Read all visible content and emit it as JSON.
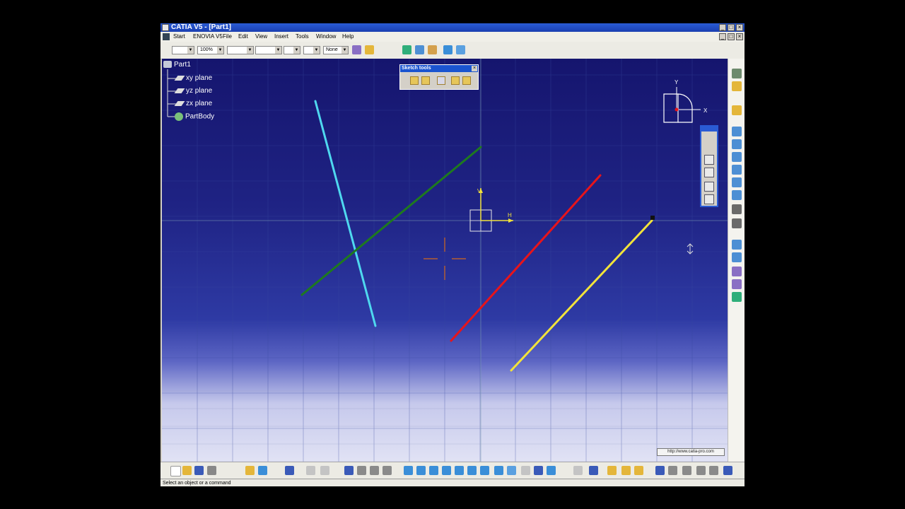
{
  "window": {
    "title": "CATIA V5 - [Part1]",
    "controls": {
      "minimize": "_",
      "maximize": "□",
      "close": "×"
    }
  },
  "menu": {
    "items": [
      "Start",
      "ENOVIA V5",
      "File",
      "Edit",
      "View",
      "Insert",
      "Tools",
      "Window",
      "Help"
    ]
  },
  "toolbar": {
    "zoom_value": "100%",
    "line_value": "None",
    "icons": [
      "line-type-icon",
      "sketch-line-icon",
      "spline-icon",
      "draft-icon",
      "surface-icon",
      "rotate-view-icon"
    ]
  },
  "tree": {
    "root": "Part1",
    "children": [
      "xy plane",
      "yz plane",
      "zx plane",
      "PartBody"
    ]
  },
  "sketch_tools": {
    "title": "Sketch tools",
    "close": "×",
    "icons": [
      "grid-icon",
      "snap-to-point-icon",
      "construction-element-icon",
      "geometrical-constraints-icon",
      "dimensional-constraints-icon"
    ]
  },
  "compass": {
    "x_label": "X",
    "y_label": "Y"
  },
  "sketch_axis": {
    "h_label": "H",
    "v_label": "V"
  },
  "colors": {
    "cyan_line": "#4fd8ef",
    "green_line": "#1e7a1e",
    "red_line": "#e8141a",
    "yellow_line": "#f2e33a",
    "background_top": "#15156e",
    "background_bottom": "#e9eaf7",
    "crosshair": "#d2691e"
  },
  "watermark": "http://www.catia-pro.com",
  "bottom_toolbar": {
    "icons": [
      "new-icon",
      "open-icon",
      "save-icon",
      "print-icon",
      "cut-icon",
      "undo-icon",
      "help-icon",
      "fx-formula-icon",
      "zoom-icon",
      "pan-icon",
      "rotate-icon",
      "zoom-in-icon",
      "zoom-out-icon",
      "normal-view-icon",
      "iso-view-icon",
      "render-icon",
      "hide-show-icon"
    ]
  },
  "right_toolbar": {
    "icons": [
      "exit-workbench-icon",
      "sketch-icon",
      "profile-icon",
      "rectangle-icon",
      "circle-icon",
      "spline-icon",
      "ellipse-icon",
      "line-icon",
      "axis-icon",
      "point-icon",
      "corner-icon",
      "chamfer-icon",
      "trim-icon",
      "mirror-icon",
      "constraint-icon"
    ]
  },
  "status": "Select an object or a command"
}
